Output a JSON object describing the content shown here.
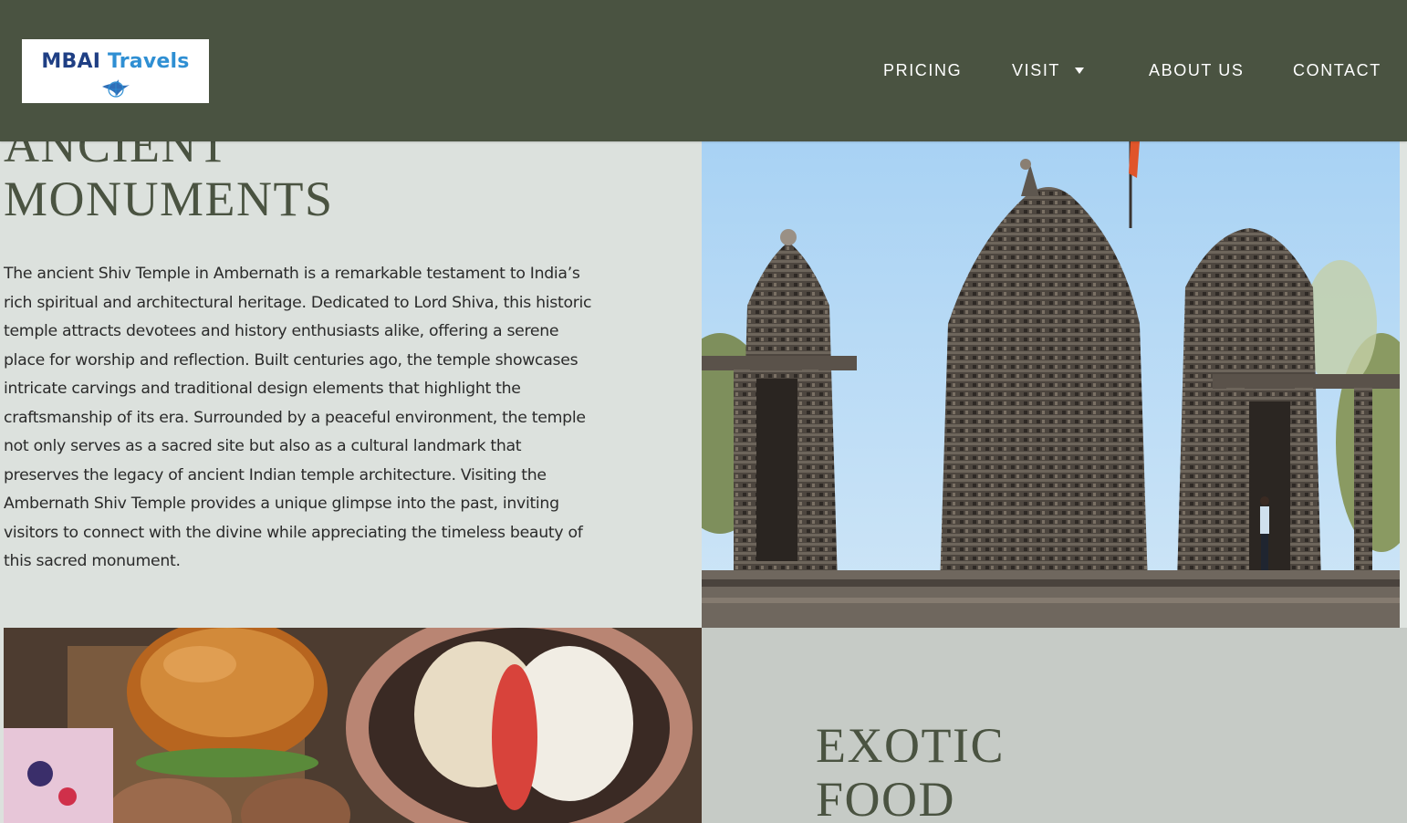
{
  "header": {
    "logo": {
      "word1": "MBAI",
      "word2": "Travels"
    },
    "nav": {
      "pricing": "PRICING",
      "visit": "VISIT",
      "about": "ABOUT US",
      "contact": "CONTACT"
    },
    "colors": {
      "background": "#4a5341",
      "text": "#ffffff"
    }
  },
  "monuments": {
    "heading": "ANCIENT\nMONUMENTS",
    "body": "The ancient Shiv Temple in Ambernath is a remarkable testament to India’s rich spiritual and architectural heritage. Dedicated to Lord Shiva, this historic temple attracts devotees and history enthusiasts alike, offering a serene place for worship and reflection. Built centuries ago, the temple showcases intricate carvings and traditional design elements that highlight the craftsmanship of its era. Surrounded by a peaceful environment, the temple not only serves as a sacred site but also as a cultural landmark that preserves the legacy of ancient Indian temple architecture. Visiting the Ambernath Shiv Temple provides a unique glimpse into the past, inviting visitors to connect with the divine while appreciating the timeless beauty of this sacred monument."
  },
  "food": {
    "heading": "EXOTIC\nFOOD"
  },
  "icons": [
    "logo-bird-icon",
    "chevron-down-icon"
  ],
  "colors": {
    "heading": "#4a5341",
    "section_light": "#dce1dd",
    "section_gray": "#c6cbc6"
  }
}
